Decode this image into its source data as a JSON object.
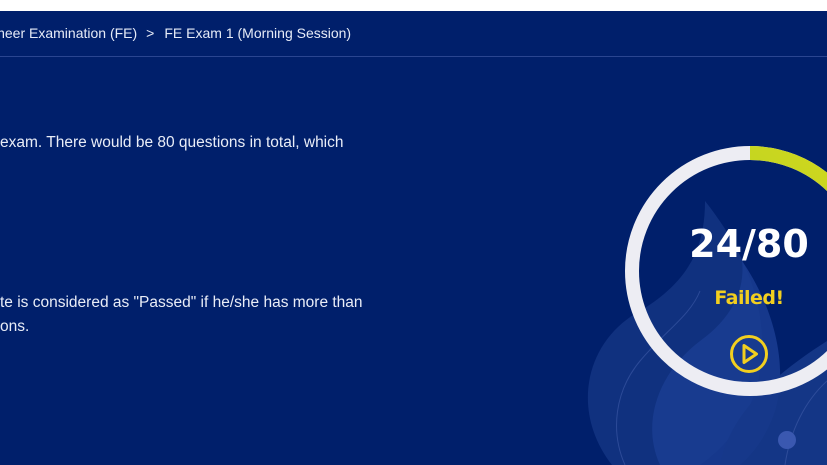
{
  "breadcrumb": {
    "items": [
      "ineer Examination (FE)",
      "FE Exam 1 (Morning Session)"
    ],
    "separator": ">"
  },
  "description": {
    "line1": "exam. There would be 80 questions in total, which",
    "line2": "te is considered as \"Passed\" if he/she has more than",
    "line3": "ons."
  },
  "result": {
    "score_text": "24/80",
    "correct": 24,
    "total": 80,
    "status": "Failed!",
    "progress_fraction": 0.3
  },
  "colors": {
    "panel_background": "#001f6b",
    "ring_track": "#ededf3",
    "status_yellow": "#f2cf1f",
    "progress_gradient_start": "#9ccf2e",
    "progress_gradient_end": "#d4d81c"
  },
  "icons": {
    "play": "play-circle-icon",
    "background": "flame-decoration"
  }
}
